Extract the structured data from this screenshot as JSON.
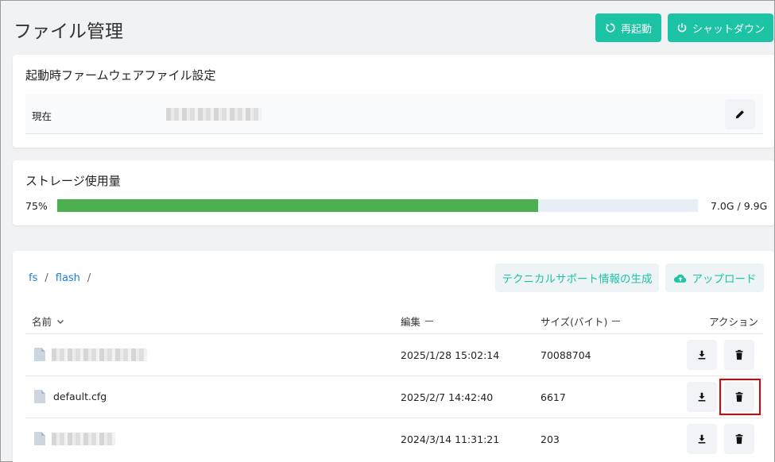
{
  "header": {
    "title": "ファイル管理",
    "restart_label": "再起動",
    "shutdown_label": "シャットダウン"
  },
  "boot_firmware": {
    "title": "起動時ファームウェアファイル設定",
    "current_label": "現在"
  },
  "storage": {
    "title": "ストレージ使用量",
    "percent_text": "75%",
    "usage_fraction": 0.75,
    "usage_text": "7.0G / 9.9G"
  },
  "files": {
    "breadcrumb": [
      {
        "label": "fs",
        "sep": "/"
      },
      {
        "label": "flash",
        "sep": "/"
      }
    ],
    "support_button_label": "テクニカルサポート情報の生成",
    "upload_button_label": "アップロード",
    "columns": {
      "name": "名前",
      "edited": "編集",
      "size": "サイズ(バイト)",
      "action": "アクション"
    },
    "rows": [
      {
        "name": "",
        "edited": "2025/1/28 15:02:14",
        "size": "70088704"
      },
      {
        "name": "default.cfg",
        "edited": "2025/2/7 14:42:40",
        "size": "6617"
      },
      {
        "name": "",
        "edited": "2024/3/14 11:31:21",
        "size": "203"
      }
    ]
  },
  "colors": {
    "accent": "#1cc3a5",
    "progress_fill": "#4caf50",
    "progress_track": "#e8eef6",
    "link": "#1a7fd4",
    "highlight": "#e00000"
  }
}
